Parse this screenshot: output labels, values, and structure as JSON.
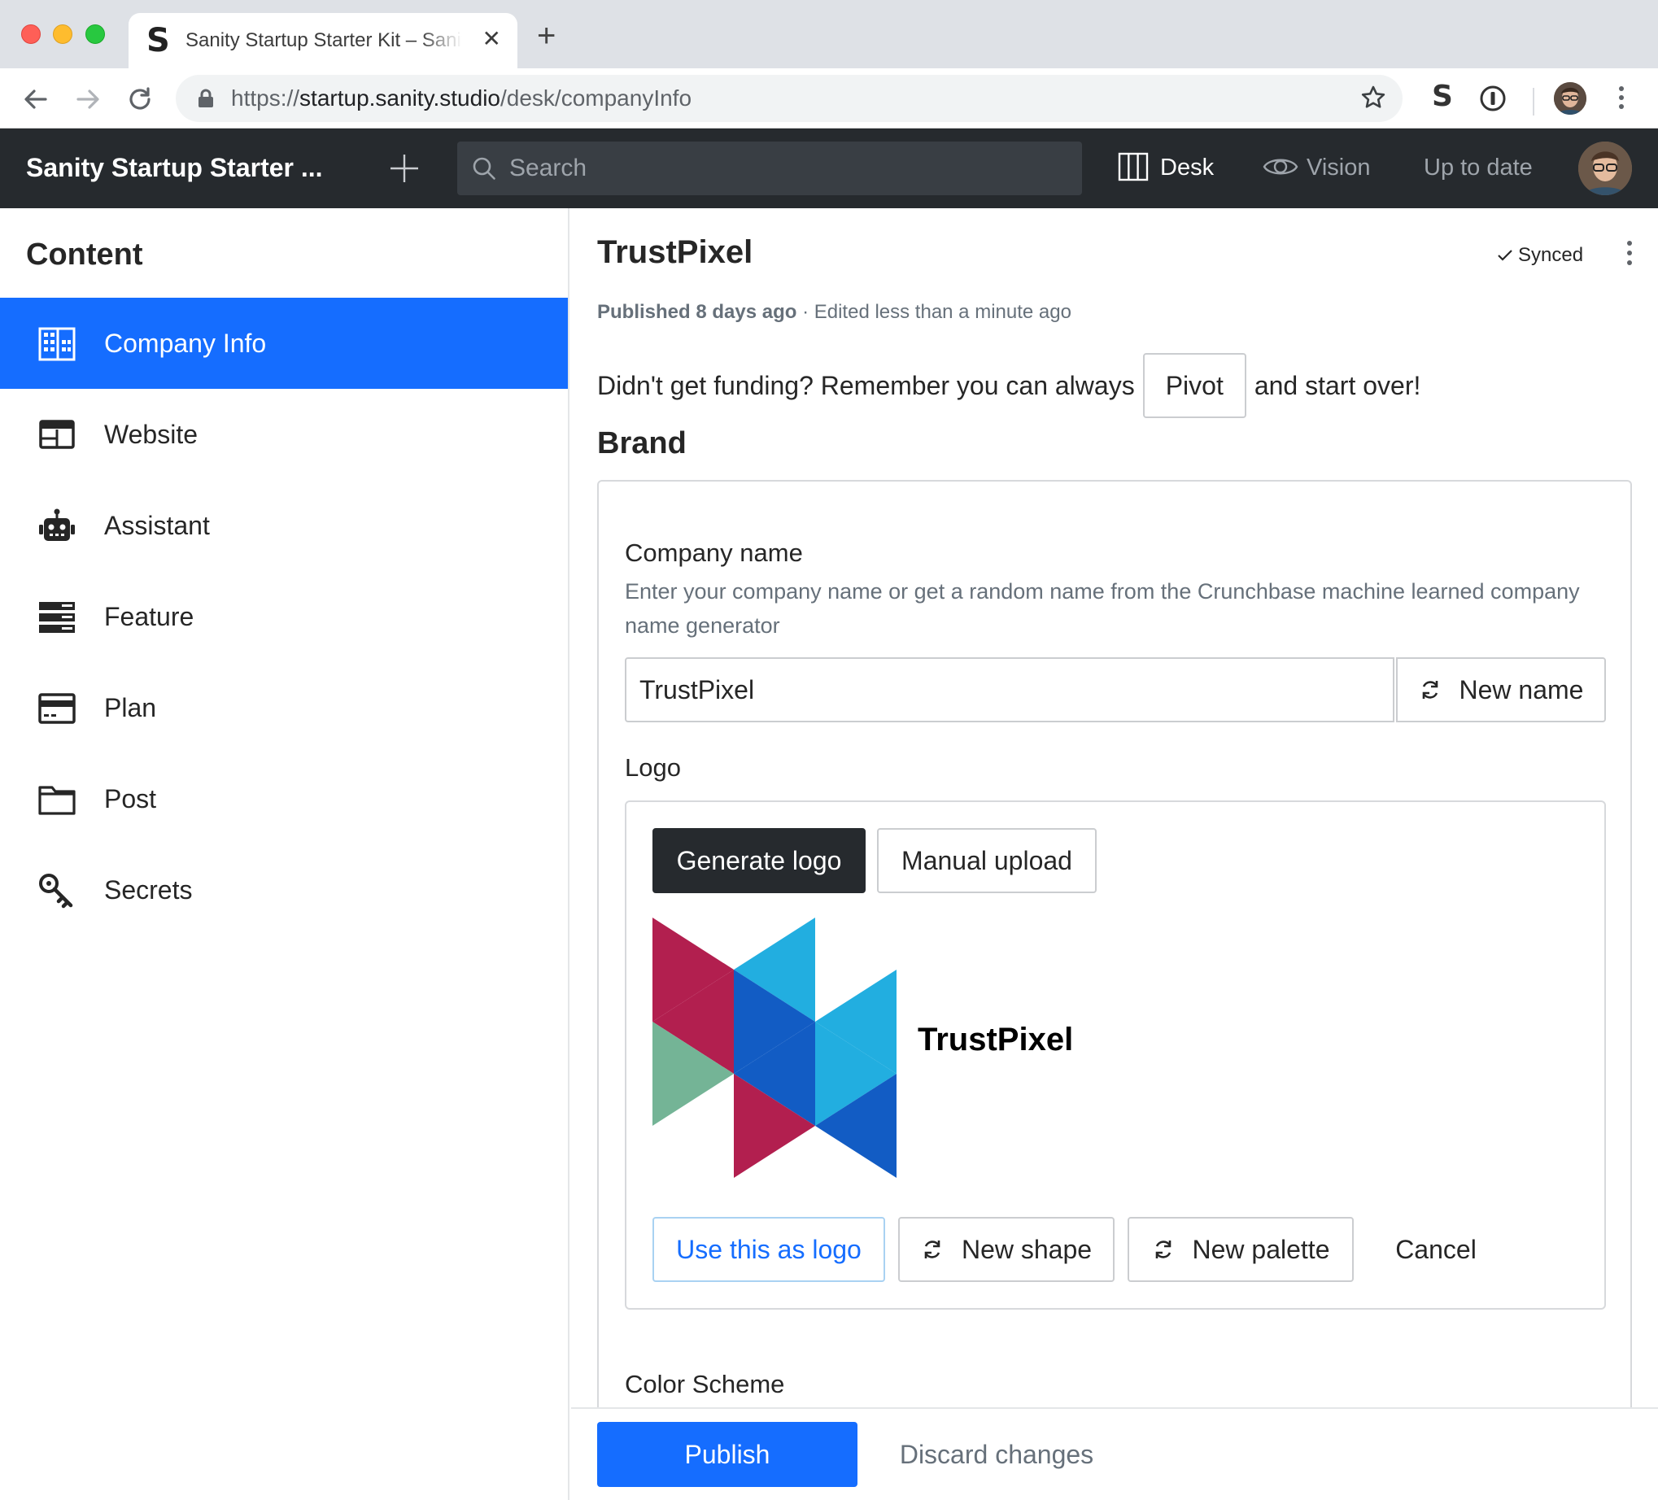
{
  "browser": {
    "tab_title": "Sanity Startup Starter Kit – Sanity",
    "tab_favicon": "S",
    "url_scheme": "https://",
    "url_host": "startup.sanity.studio",
    "url_path": "/desk/companyInfo",
    "extension_label": "S"
  },
  "appbar": {
    "title": "Sanity Startup Starter ...",
    "search_placeholder": "Search",
    "nav": {
      "desk": "Desk",
      "vision": "Vision",
      "status": "Up to date"
    }
  },
  "sidebar": {
    "title": "Content",
    "items": [
      {
        "label": "Company Info",
        "icon": "building-icon",
        "active": true
      },
      {
        "label": "Website",
        "icon": "browser-window-icon"
      },
      {
        "label": "Assistant",
        "icon": "robot-icon"
      },
      {
        "label": "Feature",
        "icon": "server-stack-icon"
      },
      {
        "label": "Plan",
        "icon": "credit-card-icon"
      },
      {
        "label": "Post",
        "icon": "folder-icon"
      },
      {
        "label": "Secrets",
        "icon": "key-icon"
      }
    ]
  },
  "document": {
    "title": "TrustPixel",
    "sync_status": "Synced",
    "published": "Published 8 days ago",
    "edited": "· Edited less than a minute ago",
    "funding_prefix": "Didn't get funding? Remember you can always",
    "pivot_label": "Pivot",
    "funding_suffix": "and start over!",
    "brand_heading": "Brand",
    "company_name": {
      "label": "Company name",
      "description": "Enter your company name or get a random name from the Crunchbase machine learned company name generator",
      "value": "TrustPixel",
      "new_name_label": "New name"
    },
    "logo": {
      "label": "Logo",
      "generate_label": "Generate logo",
      "manual_label": "Manual upload",
      "preview_name": "TrustPixel",
      "use_label": "Use this as logo",
      "new_shape_label": "New shape",
      "new_palette_label": "New palette",
      "cancel_label": "Cancel",
      "palette": [
        "#b21f4f",
        "#22aee0",
        "#125cc4",
        "#74b496"
      ]
    },
    "color_scheme_label": "Color Scheme"
  },
  "footer": {
    "publish_label": "Publish",
    "discard_label": "Discard changes"
  },
  "colors": {
    "accent": "#156dff",
    "appbar_bg": "#262a2e"
  }
}
